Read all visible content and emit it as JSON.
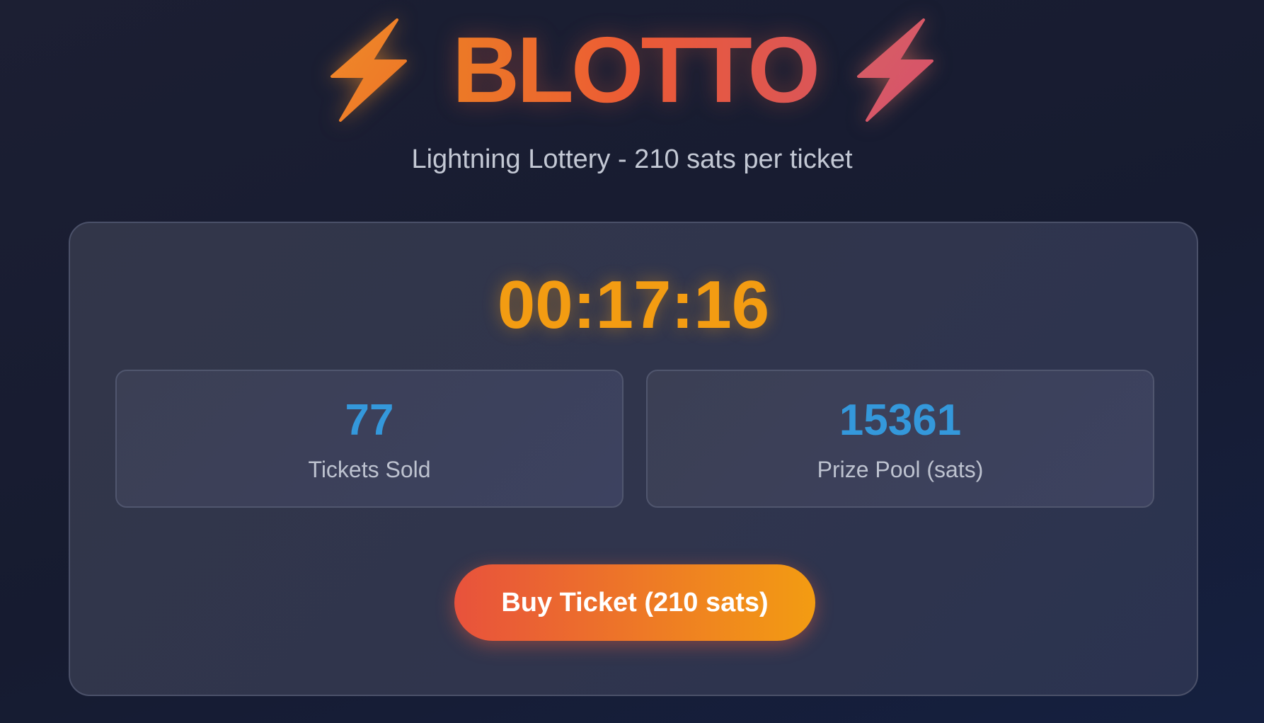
{
  "header": {
    "title": "BLOTTO",
    "subtitle": "Lightning Lottery - 210 sats per ticket",
    "icons": [
      "lightning-bolt-icon",
      "lightning-bolt-icon"
    ]
  },
  "main": {
    "timer": "00:17:16",
    "stats": [
      {
        "value": "77",
        "label": "Tickets Sold"
      },
      {
        "value": "15361",
        "label": "Prize Pool (sats)"
      }
    ],
    "buy_button_label": "Buy Ticket (210 sats)"
  },
  "colors": {
    "background": "#1a1d33",
    "title_gradient_start": "#ec7a26",
    "title_gradient_end": "#db5657",
    "timer": "#f39c12",
    "stat_value": "#3498db",
    "button_gradient_start": "#e8523c",
    "button_gradient_end": "#f39c12"
  }
}
